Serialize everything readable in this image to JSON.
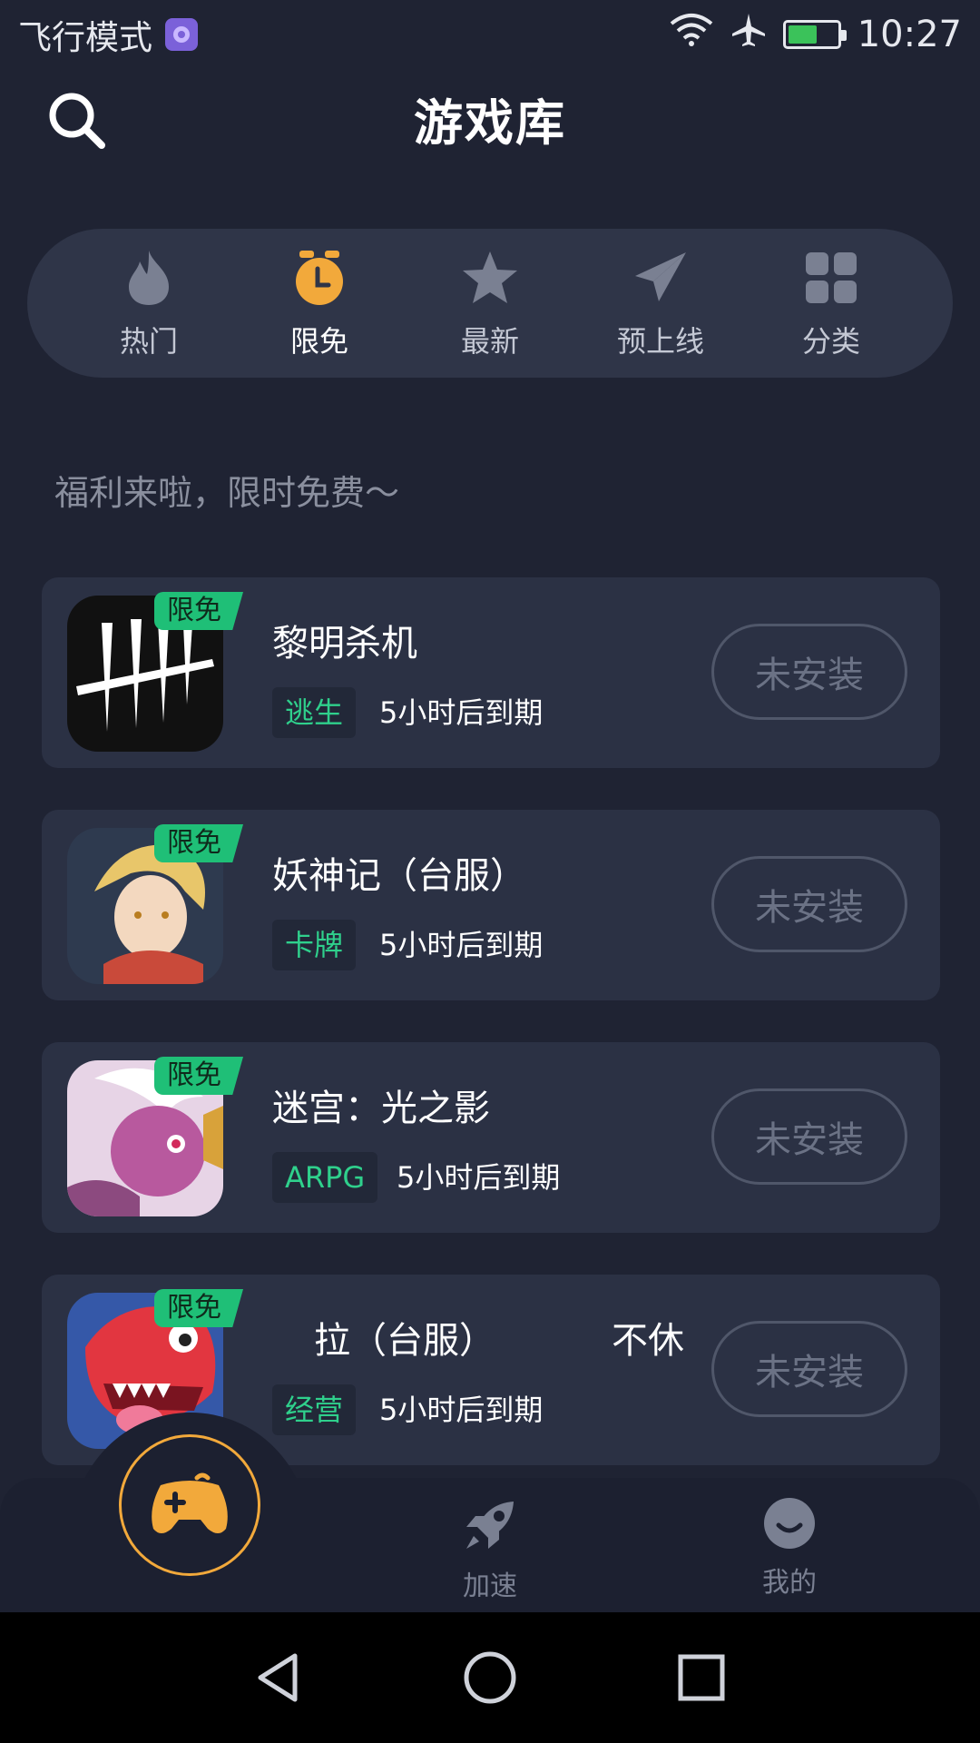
{
  "status_bar": {
    "mode_text": "飞行模式",
    "time": "10:27"
  },
  "header": {
    "title": "游戏库"
  },
  "tabs": [
    {
      "label": "热门",
      "icon": "flame-icon"
    },
    {
      "label": "限免",
      "icon": "timer-icon",
      "active": true
    },
    {
      "label": "最新",
      "icon": "star-icon"
    },
    {
      "label": "预上线",
      "icon": "paper-plane-icon"
    },
    {
      "label": "分类",
      "icon": "grid-icon"
    }
  ],
  "subtitle": "福利来啦，限时免费～",
  "games": [
    {
      "badge": "限免",
      "name": "黎明杀机",
      "tag": "逃生",
      "expire": "5小时后到期",
      "button": "未安装"
    },
    {
      "badge": "限免",
      "name": "妖神记（台服）",
      "tag": "卡牌",
      "expire": "5小时后到期",
      "button": "未安装"
    },
    {
      "badge": "限免",
      "name": "迷宫：光之影",
      "tag": "ARPG",
      "expire": "5小时后到期",
      "button": "未安装"
    },
    {
      "badge": "限免",
      "name": "拉（台服）",
      "name_extra": "不休",
      "tag": "经营",
      "expire": "5小时后到期",
      "button": "未安装"
    }
  ],
  "bottom_nav": [
    {
      "label": "加速",
      "icon": "rocket-icon"
    },
    {
      "label": "我的",
      "icon": "smiley-icon"
    }
  ],
  "colors": {
    "background": "#1f2333",
    "card": "#2b3144",
    "accent_green": "#1fbf77",
    "accent_orange": "#f2a93b"
  }
}
